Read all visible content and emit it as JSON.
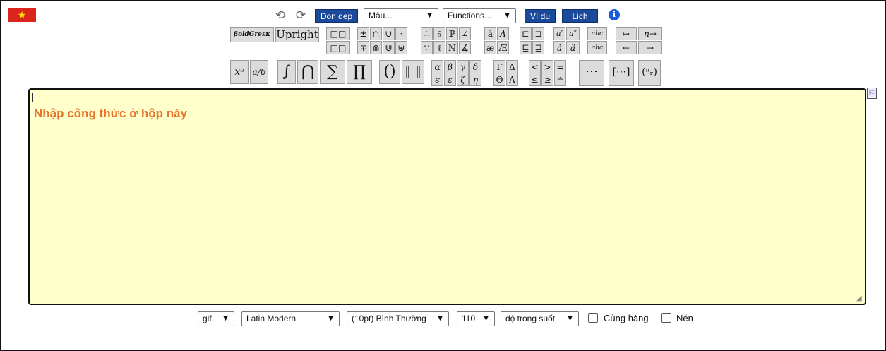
{
  "flag": {
    "label": "Vietnamese flag",
    "star": "★"
  },
  "toolbar": {
    "undo_icon": "⟲",
    "redo_icon": "⟳",
    "clean_label": "Don dep",
    "color_select": "Màu...",
    "functions_select": "Functions...",
    "example_label": "Ví dụ",
    "history_label": "Lịch sử",
    "info_icon": "i"
  },
  "symbols": {
    "row1": [
      {
        "name": "bold-greek-button",
        "text": "βoldGreεκ"
      },
      {
        "name": "upright-button",
        "text": "Upright"
      },
      {
        "name": "boxes-button-1",
        "text": "□□"
      },
      {
        "name": "plusminus-button",
        "text": "±"
      },
      {
        "name": "cap-button",
        "text": "∩"
      },
      {
        "name": "cup-button",
        "text": "∪"
      },
      {
        "name": "cdot-button",
        "text": "·"
      },
      {
        "name": "therefore-button",
        "text": "∴"
      },
      {
        "name": "partial-button",
        "text": "∂"
      },
      {
        "name": "mathbb-p-button",
        "text": "ℙ"
      },
      {
        "name": "angle-button",
        "text": "∠"
      },
      {
        "name": "a-grave-button",
        "text": "à"
      },
      {
        "name": "cal-a-button",
        "text": "A"
      },
      {
        "name": "subset-button",
        "text": "⊏"
      },
      {
        "name": "supset-button",
        "text": "⊐"
      },
      {
        "name": "a-prime-button",
        "text": "a′"
      },
      {
        "name": "a-dprime-button",
        "text": "a″"
      },
      {
        "name": "widetilde-button",
        "text": "abc"
      },
      {
        "name": "mapsto-button",
        "text": "↦"
      },
      {
        "name": "n-to-button",
        "text": "n→"
      }
    ],
    "row2": [
      {
        "name": "boxes-button-2",
        "text": "□□"
      },
      {
        "name": "minusplus-button",
        "text": "∓"
      },
      {
        "name": "bigcap-button",
        "text": "⋒"
      },
      {
        "name": "bigcup-button",
        "text": "⋓"
      },
      {
        "name": "uplus-button",
        "text": "⊎"
      },
      {
        "name": "because-button",
        "text": "∵"
      },
      {
        "name": "imath-button",
        "text": "ℓ"
      },
      {
        "name": "mathbb-n-button",
        "text": "ℕ"
      },
      {
        "name": "measuredangle-button",
        "text": "∡"
      },
      {
        "name": "ae-button",
        "text": "æ"
      },
      {
        "name": "AE-button",
        "text": "Æ"
      },
      {
        "name": "sqsubseteq-button",
        "text": "⊑"
      },
      {
        "name": "sqsupseteq-button",
        "text": "⊒"
      },
      {
        "name": "a-dot-button",
        "text": "ȧ"
      },
      {
        "name": "a-ddot-button",
        "text": "ä"
      },
      {
        "name": "widehat-button",
        "text": "abc"
      },
      {
        "name": "leftarrow-button",
        "text": "←"
      },
      {
        "name": "rightarrow-button",
        "text": "→"
      }
    ],
    "row3_big": [
      {
        "name": "superscript-button",
        "text": "xᵃ"
      },
      {
        "name": "fraction-button",
        "text": "a/b"
      },
      {
        "name": "integral-button",
        "text": "∫"
      },
      {
        "name": "bigcap-operator-button",
        "text": "⋂"
      },
      {
        "name": "sum-button",
        "text": "∑"
      },
      {
        "name": "product-button",
        "text": "∏"
      },
      {
        "name": "parentheses-button",
        "text": "()"
      },
      {
        "name": "norm-button",
        "text": "‖ ‖"
      },
      {
        "name": "ellipsis-button",
        "text": "⋯"
      },
      {
        "name": "matrix-button",
        "text": "[⋯]"
      },
      {
        "name": "binomial-button",
        "text": "(ⁿᵣ)"
      }
    ],
    "greek_row1": [
      "α",
      "β",
      "γ",
      "δ",
      "Γ",
      "Δ",
      "<",
      ">",
      "="
    ],
    "greek_row2": [
      "ϵ",
      "ε",
      "ζ",
      "η",
      "Θ",
      "Λ",
      "≤",
      "≥",
      "≐"
    ]
  },
  "editor": {
    "placeholder": "Nhập công thức ở hộp này",
    "copy_icon": "⎘"
  },
  "bottom": {
    "format": "gif",
    "font": "Latin Modern",
    "size": "(10pt) Bình Thường",
    "dpi": "110",
    "background": "độ trong suốt",
    "inline_label": "Cùng hàng",
    "compress_label": "Nén"
  }
}
